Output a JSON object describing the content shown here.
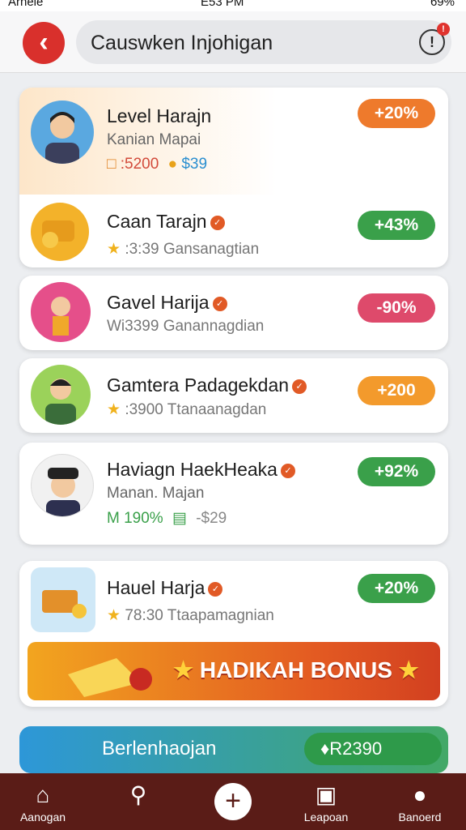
{
  "status": {
    "carrier": "Arnele",
    "time": "E53 PM",
    "battery": "69%"
  },
  "header": {
    "search_text": "Causwken Injohigan",
    "notification_badge": "!"
  },
  "cards": [
    {
      "name": "Level Harajn",
      "subtitle": "Kanian Mapai",
      "meta": [
        ":5200",
        "$39"
      ],
      "change": "+20%",
      "change_color": "#ee7a2c"
    },
    {
      "name": "Caan Tarajn",
      "meta_text": ":3:39 Gansanagtian",
      "change": "+43%",
      "change_color": "#3aa04a"
    },
    {
      "name": "Gavel Harija",
      "meta_text": "Wi3399 Ganannagdian",
      "change": "-90%",
      "change_color": "#de4a6b"
    },
    {
      "name": "Gamtera Padagekdan",
      "meta_text": ":3900 Ttanaanagdan",
      "change": "+200",
      "change_color": "#f39a2c"
    },
    {
      "name": "Haviagn HaekHeaka",
      "subtitle": "Manan. Majan",
      "meta": [
        "M 190%",
        "-$29"
      ],
      "change": "+92%",
      "change_color": "#3aa04a"
    },
    {
      "name": "Hauel Harja",
      "meta_text": "78:30 Ttaapamagnian",
      "change": "+20%",
      "change_color": "#3aa04a"
    }
  ],
  "banner": {
    "label": "HADIKAH BONUS"
  },
  "bottom_card": {
    "title": "Berlenhaojan",
    "pill": "♦R2390"
  },
  "nav": {
    "home": "Aanogan",
    "leaderboard": "Leapoan",
    "profile": "Banoerd"
  }
}
